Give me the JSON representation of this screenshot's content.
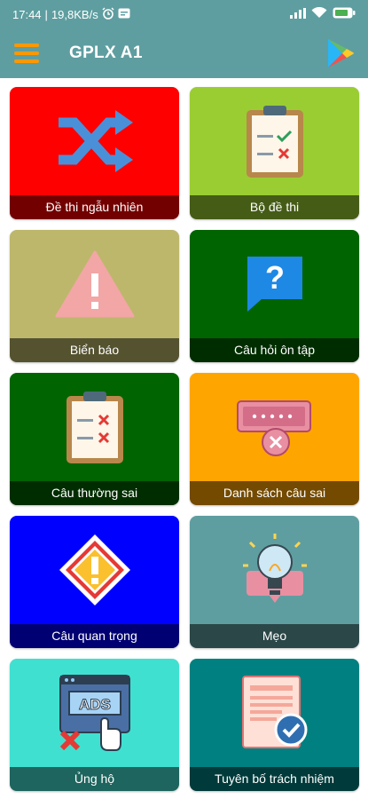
{
  "status": {
    "time": "17:44",
    "speed": "19,8KB/s",
    "alarm_icon": "alarm-icon",
    "message_icon": "message-icon",
    "signal_icon": "signal-icon",
    "wifi_icon": "wifi-icon",
    "battery_icon": "battery-icon",
    "battery_text": "80"
  },
  "appbar": {
    "title": "GPLX A1",
    "menu_icon": "hamburger-menu-icon",
    "store_icon": "google-play-icon"
  },
  "colors": {
    "appbar": "#5f9ea0",
    "menu": "#ff9800"
  },
  "tiles": [
    {
      "label": "Đề thi ngẫu nhiên",
      "bg": "#ff0000",
      "icon": "shuffle-icon"
    },
    {
      "label": "Bộ đề thi",
      "bg": "#9acd32",
      "icon": "clipboard-check-icon"
    },
    {
      "label": "Biển báo",
      "bg": "#bdb76b",
      "icon": "warning-triangle-icon"
    },
    {
      "label": "Câu hỏi ôn tập",
      "bg": "#006400",
      "icon": "question-bubble-icon"
    },
    {
      "label": "Câu thường sai",
      "bg": "#006400",
      "icon": "clipboard-wrong-icon"
    },
    {
      "label": "Danh sách câu sai",
      "bg": "#ffa500",
      "icon": "ticket-error-icon"
    },
    {
      "label": "Câu quan trọng",
      "bg": "#0000ff",
      "icon": "warning-diamond-icon"
    },
    {
      "label": "Mẹo",
      "bg": "#5f9ea0",
      "icon": "lightbulb-idea-icon"
    },
    {
      "label": "Ủng hộ",
      "bg": "#40e0d0",
      "icon": "ads-support-icon"
    },
    {
      "label": "Tuyên bố trách nhiệm",
      "bg": "#008080",
      "icon": "document-verified-icon"
    }
  ]
}
